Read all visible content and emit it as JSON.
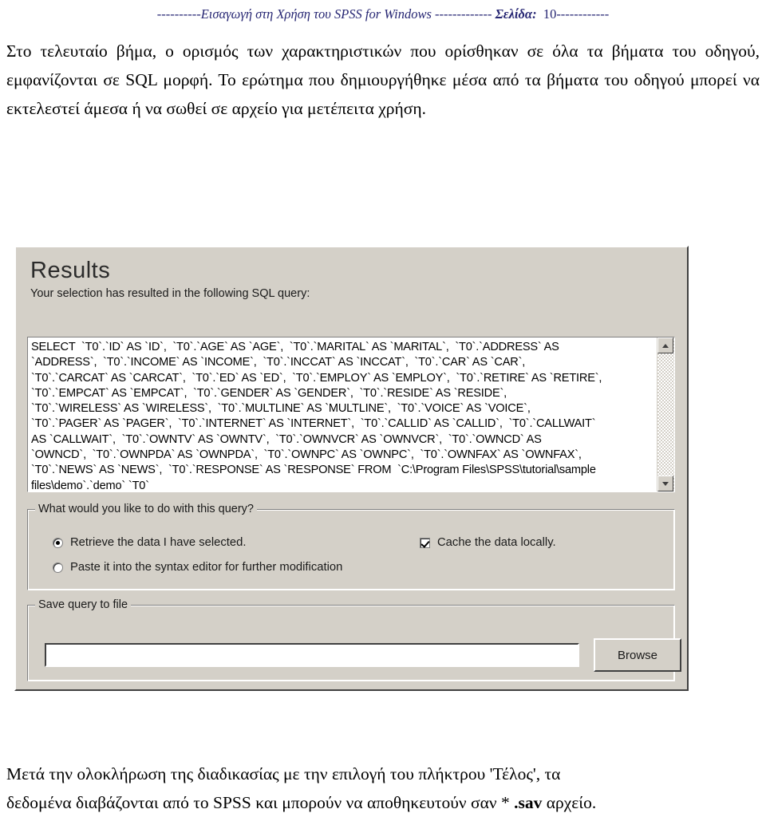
{
  "document": {
    "header": {
      "lead_dashes": "----------",
      "title_italic": "Εισαγωγή στη Χρήση του SPSS for Windows",
      "mid_dashes": " ------------- ",
      "page_label": "Σελίδα:",
      "page_number": "10",
      "trail_dashes": "------------"
    },
    "paragraph_top": "Στο τελευταίο βήμα, ο ορισμός των χαρακτηριστικών που ορίσθηκαν σε όλα τα βήματα του οδηγού, εμφανίζονται σε SQL μορφή. Το ερώτημα που δημιουργήθηκε μέσα από τα βήματα του οδηγού μπορεί να εκτελεστεί άμεσα ή να σωθεί σε αρχείο για μετέπειτα χρήση.",
    "paragraph_bottom_line1": "Μετά την ολοκλήρωση της διαδικασίας με την επιλογή του πλήκτρου 'Τέλος', τα",
    "paragraph_bottom_line2_a": "δεδομένα διαβάζονται από το SPSS και μπορούν να αποθηκευτούν σαν * ",
    "paragraph_bottom_line2_b": ".sav",
    "paragraph_bottom_line2_c": " αρχείο."
  },
  "dialog": {
    "title": "Results",
    "subtitle": "Your selection has resulted in the following SQL query:",
    "sql_query": "SELECT  `T0`.`ID` AS `ID`,  `T0`.`AGE` AS `AGE`,  `T0`.`MARITAL` AS `MARITAL`,  `T0`.`ADDRESS` AS\n`ADDRESS`,  `T0`.`INCOME` AS `INCOME`,  `T0`.`INCCAT` AS `INCCAT`,  `T0`.`CAR` AS `CAR`,\n`T0`.`CARCAT` AS `CARCAT`,  `T0`.`ED` AS `ED`,  `T0`.`EMPLOY` AS `EMPLOY`,  `T0`.`RETIRE` AS `RETIRE`,\n`T0`.`EMPCAT` AS `EMPCAT`,  `T0`.`GENDER` AS `GENDER`,  `T0`.`RESIDE` AS `RESIDE`,\n`T0`.`WIRELESS` AS `WIRELESS`,  `T0`.`MULTLINE` AS `MULTLINE`,  `T0`.`VOICE` AS `VOICE`,\n`T0`.`PAGER` AS `PAGER`,  `T0`.`INTERNET` AS `INTERNET`,  `T0`.`CALLID` AS `CALLID`,  `T0`.`CALLWAIT`\nAS `CALLWAIT`,  `T0`.`OWNTV` AS `OWNTV`,  `T0`.`OWNVCR` AS `OWNVCR`,  `T0`.`OWNCD` AS\n`OWNCD`,  `T0`.`OWNPDA` AS `OWNPDA`,  `T0`.`OWNPC` AS `OWNPC`,  `T0`.`OWNFAX` AS `OWNFAX`,\n`T0`.`NEWS` AS `NEWS`,  `T0`.`RESPONSE` AS `RESPONSE` FROM  `C:\\Program Files\\SPSS\\tutorial\\sample\nfiles\\demo`.`demo` `T0`",
    "scrollbar": {
      "up_icon": "triangle-up-icon",
      "down_icon": "triangle-down-icon"
    },
    "query_group": {
      "legend": "What would you like to do with this query?",
      "options": [
        {
          "label": "Retrieve the data I have selected.",
          "checked": true
        },
        {
          "label": "Paste it into the syntax editor for further modification",
          "checked": false
        }
      ],
      "cache_checkbox": {
        "label": "Cache the data locally.",
        "checked": true
      }
    },
    "save_group": {
      "legend": "Save query to file",
      "file_value": "",
      "file_placeholder": "",
      "browse_label": "Browse"
    }
  }
}
